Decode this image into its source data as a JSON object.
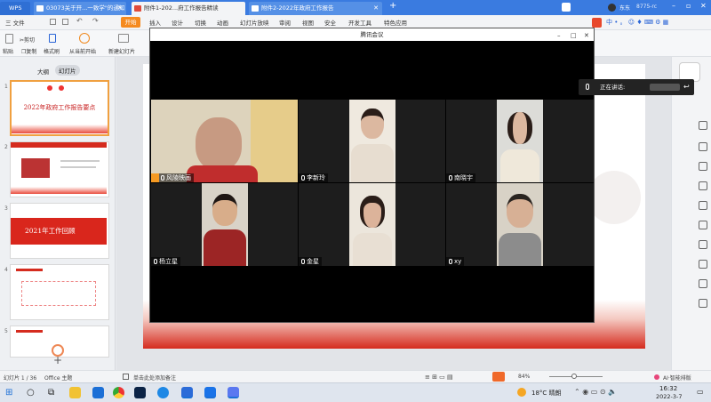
{
  "titlebar": {
    "wps_label": "WPS",
    "tabs": [
      {
        "label": "03073关于开...一致学\"的通知"
      },
      {
        "label": "附件1-202...府工作报告精读"
      },
      {
        "label": "附件2-2022年政府工作报告"
      }
    ],
    "new_tab": "+",
    "user": "东东",
    "user_id": "8775-rc"
  },
  "menubar": {
    "file": "三 文件",
    "start": "开始",
    "items": [
      "插入",
      "设计",
      "切换",
      "动画",
      "幻灯片放映",
      "审阅",
      "视图",
      "安全",
      "开发工具",
      "特色应用"
    ]
  },
  "toolbar": {
    "paste": "粘贴",
    "cut": "剪切",
    "copy": "复制",
    "format_painter": "格式刷",
    "from_current": "从当前开始",
    "new_slide": "新建幻灯片"
  },
  "leftpanel": {
    "tab_outline": "大纲",
    "tab_slides": "幻灯片",
    "slides": [
      {
        "num": "1",
        "title": "2022年政府工作报告要点"
      },
      {
        "num": "2",
        "title": ""
      },
      {
        "num": "3",
        "title": "2021年工作回顾"
      },
      {
        "num": "4",
        "title": ""
      },
      {
        "num": "5",
        "title": ""
      }
    ],
    "add": "+"
  },
  "meeting": {
    "title": "腾讯会议",
    "minimize": "–",
    "maximize": "□",
    "close": "✕",
    "participants": [
      {
        "name": "风陵映画",
        "host": true
      },
      {
        "name": "李新玲"
      },
      {
        "name": "南晓宇"
      },
      {
        "name": "杨立星"
      },
      {
        "name": "金星"
      },
      {
        "name": "xy"
      }
    ]
  },
  "speaking": {
    "label": "正在讲话:"
  },
  "statusbar": {
    "slide_info": "幻灯片 1 / 36",
    "theme": "Office 主题",
    "notes": "单击此处添加备注",
    "zoom": "84%",
    "ai": "AI·智能排版"
  },
  "taskbar": {
    "weather": "18°C 晴朗",
    "time": "16:32",
    "date": "2022-3-7"
  },
  "colors": {
    "accent_blue": "#3a7be0",
    "wps_orange": "#f58a1f",
    "slide_red": "#d52b1e"
  }
}
